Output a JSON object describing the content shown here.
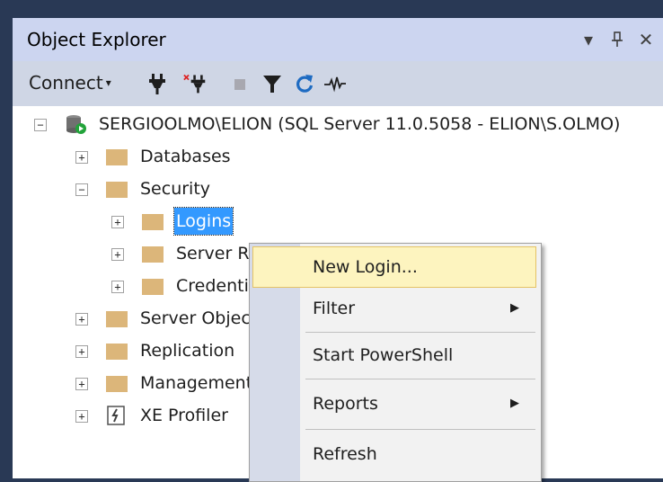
{
  "panel": {
    "title": "Object Explorer",
    "controls": [
      "▾",
      "ᵖ",
      "✕"
    ]
  },
  "toolbar": {
    "connect_label": "Connect",
    "connect_caret": "▾",
    "icons": [
      "connect-plug-icon",
      "disconnect-plug-icon",
      "stop-icon",
      "filter-icon",
      "refresh-icon",
      "activity-monitor-icon"
    ]
  },
  "tree": {
    "server": {
      "label": "SERGIOOLMO\\ELION (SQL Server 11.0.5058 - ELION\\S.OLMO)",
      "expander": "−"
    },
    "nodes": [
      {
        "label": "Databases",
        "expander": "+"
      },
      {
        "label": "Security",
        "expander": "−"
      },
      {
        "label": "Logins",
        "expander": "+"
      },
      {
        "label": "Server Roles",
        "expander": "+"
      },
      {
        "label": "Credentials",
        "expander": "+"
      },
      {
        "label": "Server Objects",
        "expander": "+"
      },
      {
        "label": "Replication",
        "expander": "+"
      },
      {
        "label": "Management",
        "expander": "+"
      },
      {
        "label": "XE Profiler",
        "expander": "+"
      }
    ]
  },
  "context_menu": {
    "items": [
      {
        "label": "New Login...",
        "arrow": ""
      },
      {
        "label": "Filter",
        "arrow": "▶"
      },
      {
        "label": "Start PowerShell",
        "arrow": ""
      },
      {
        "label": "Reports",
        "arrow": "▶"
      },
      {
        "label": "Refresh",
        "arrow": ""
      }
    ]
  },
  "colors": {
    "frame": "#293955",
    "titlebar": "#ccd5f0",
    "selection": "#3399ff",
    "menu_highlight": "#fdf4bf",
    "folder": "#dcb67a"
  }
}
